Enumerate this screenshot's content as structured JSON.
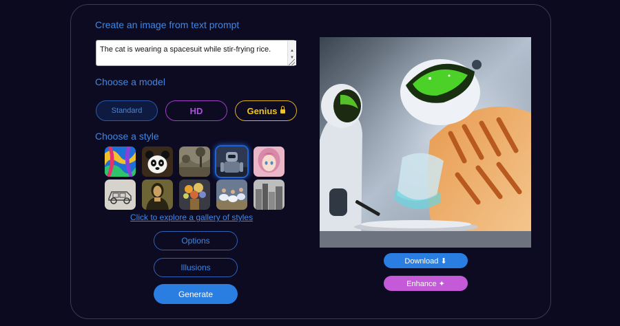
{
  "headings": {
    "create": "Create an image from text prompt",
    "model": "Choose a model",
    "style": "Choose a style"
  },
  "prompt": {
    "value": "The cat is wearing a spacesuit while stir-frying rice."
  },
  "models": {
    "standard": "Standard",
    "hd": "HD",
    "genius": "Genius"
  },
  "styles": {
    "selected_index": 3,
    "thumbnails": [
      "abstract-colorful-paint-icon",
      "panda-icon",
      "landscape-painting-icon",
      "robot-character-icon",
      "anime-girl-icon",
      "sketch-car-icon",
      "mona-lisa-icon",
      "flower-bouquet-icon",
      "dancers-icon",
      "sketch-city-icon"
    ],
    "gallery_link": "Click to explore a gallery of styles"
  },
  "buttons": {
    "options": "Options",
    "illusions": "Illusions",
    "generate": "Generate",
    "download": "Download ⬇",
    "enhance": "Enhance ✦"
  },
  "colors": {
    "accent": "#3f88e6",
    "primary_button": "#2a7de1",
    "enhance_button": "#c45ad8",
    "hd": "#b24fe0",
    "genius": "#f0c418",
    "background": "#0b0a1f"
  }
}
